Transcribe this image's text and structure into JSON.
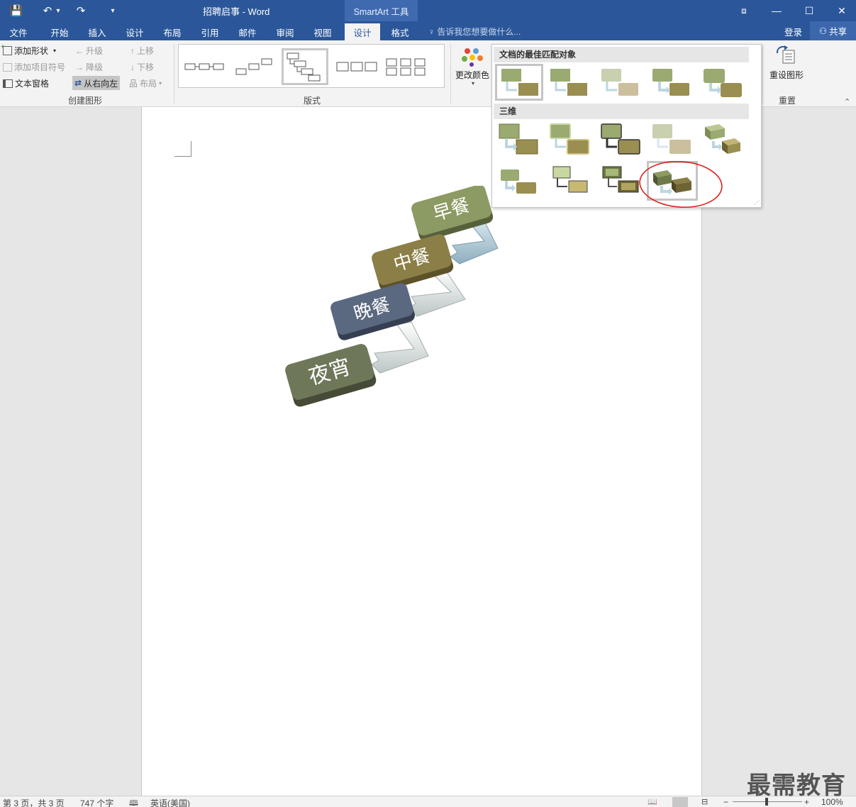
{
  "window": {
    "title": "招聘启事 - Word",
    "contextual_tool": "SmartArt 工具",
    "minimize": "—",
    "maximize": "☐",
    "close": "✕",
    "ribbon_display": "⧈"
  },
  "quick_access": {
    "save": "💾",
    "undo": "↶",
    "undo_dd": "▾",
    "redo": "↷",
    "customize": "▾"
  },
  "tabs": [
    {
      "label": "文件"
    },
    {
      "label": "开始"
    },
    {
      "label": "插入"
    },
    {
      "label": "设计"
    },
    {
      "label": "布局"
    },
    {
      "label": "引用"
    },
    {
      "label": "邮件"
    },
    {
      "label": "审阅"
    },
    {
      "label": "视图"
    },
    {
      "label": "设计"
    },
    {
      "label": "格式"
    }
  ],
  "tell_me": "告诉我您想要做什么...",
  "login": "登录",
  "share": "共享",
  "ribbon": {
    "create_graphic": {
      "add_shape": "添加形状",
      "add_bullet": "添加项目符号",
      "text_pane": "文本窗格",
      "promote": "升级",
      "demote": "降级",
      "right_to_left": "从右向左",
      "move_up": "上移",
      "move_down": "下移",
      "layout": "布局",
      "label": "创建图形"
    },
    "layouts": {
      "label": "版式"
    },
    "change_colors": "更改颜色",
    "reset": {
      "button": "重设图形",
      "label": "重置"
    }
  },
  "style_panel": {
    "section_best": "文档的最佳匹配对象",
    "section_3d": "三维"
  },
  "smartart": {
    "items": [
      "早餐",
      "中餐",
      "晚餐",
      "夜宵"
    ],
    "colors": [
      "#8c9a63",
      "#8b7e46",
      "#5a6880",
      "#6e7859"
    ]
  },
  "status": {
    "page": "第 3 页，共 3 页",
    "words": "747 个字",
    "language": "英语(美国)",
    "zoom": "100%"
  },
  "watermark": "最需教育"
}
